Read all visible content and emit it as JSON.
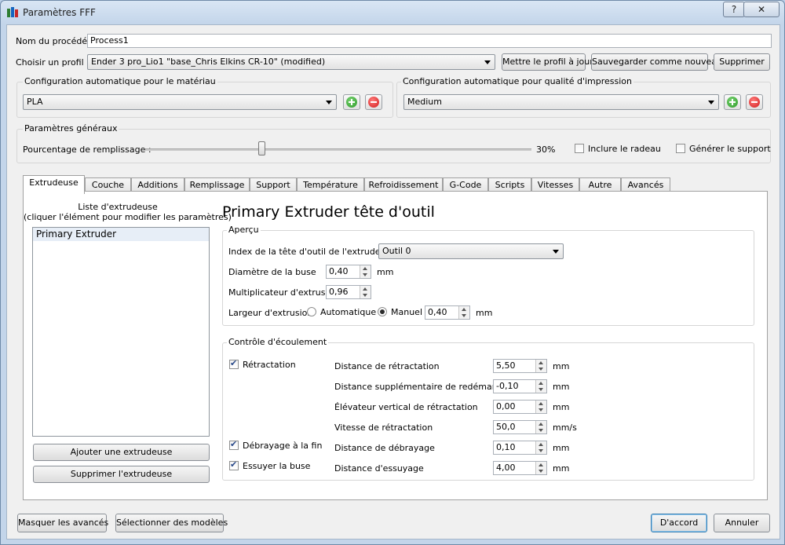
{
  "window": {
    "title": "Paramètres FFF",
    "help": "?",
    "close": "✕"
  },
  "process": {
    "label": "Nom du procédé :",
    "value": "Process1"
  },
  "profile": {
    "label": "Choisir un profil :",
    "value": "Ender 3 pro_Lio1 \"base_Chris Elkins CR-10\" (modified)",
    "update": "Mettre le profil à jour",
    "save_new": "Sauvegarder comme nouveau",
    "delete": "Supprimer"
  },
  "material": {
    "label": "Configuration automatique pour le matériau",
    "value": "PLA"
  },
  "quality": {
    "label": "Configuration automatique pour qualité d'impression",
    "value": "Medium"
  },
  "general": {
    "label": "Paramètres généraux",
    "infill_label": "Pourcentage de remplissage :",
    "infill_value": "30%",
    "infill_fraction": 0.3,
    "raft": "Inclure le radeau",
    "support": "Générer le support"
  },
  "tabs": [
    "Extrudeuse",
    "Couche",
    "Additions",
    "Remplissage",
    "Support",
    "Température",
    "Refroidissement",
    "G-Code",
    "Scripts",
    "Vitesses",
    "Autre",
    "Avancés"
  ],
  "extruder_list": {
    "title1": "Liste d'extrudeuse",
    "title2": "(cliquer l'élément pour modifier les paramètres)",
    "items": [
      "Primary Extruder"
    ],
    "add": "Ajouter une extrudeuse",
    "remove": "Supprimer l'extrudeuse"
  },
  "panel": {
    "heading": "Primary Extruder tête d'outil",
    "overview": {
      "label": "Aperçu",
      "tool_index_label": "Index de la tête d'outil de l'extrudeuse",
      "tool_index_value": "Outil 0",
      "nozzle_label": "Diamètre de la buse",
      "nozzle_value": "0,40",
      "nozzle_unit": "mm",
      "mult_label": "Multiplicateur d'extrusion",
      "mult_value": "0,96",
      "width_label": "Largeur d'extrusion",
      "auto": "Automatique",
      "manual": "Manuel",
      "width_value": "0,40",
      "width_unit": "mm"
    },
    "flow": {
      "label": "Contrôle d'écoulement",
      "retraction": "Rétractation",
      "coast": "Débrayage à la fin",
      "wipe": "Essuyer la buse",
      "rows": [
        {
          "label": "Distance de rétractation",
          "value": "5,50",
          "unit": "mm"
        },
        {
          "label": "Distance supplémentaire de redémarrage",
          "value": "-0,10",
          "unit": "mm"
        },
        {
          "label": "Élévateur vertical de rétractation",
          "value": "0,00",
          "unit": "mm"
        },
        {
          "label": "Vitesse de rétractation",
          "value": "50,0",
          "unit": "mm/s"
        },
        {
          "label": "Distance de débrayage",
          "value": "0,10",
          "unit": "mm"
        },
        {
          "label": "Distance d'essuyage",
          "value": "4,00",
          "unit": "mm"
        }
      ]
    }
  },
  "footer": {
    "hide_advanced": "Masquer les avancés",
    "select_models": "Sélectionner des modèles",
    "ok": "D'accord",
    "cancel": "Annuler"
  }
}
